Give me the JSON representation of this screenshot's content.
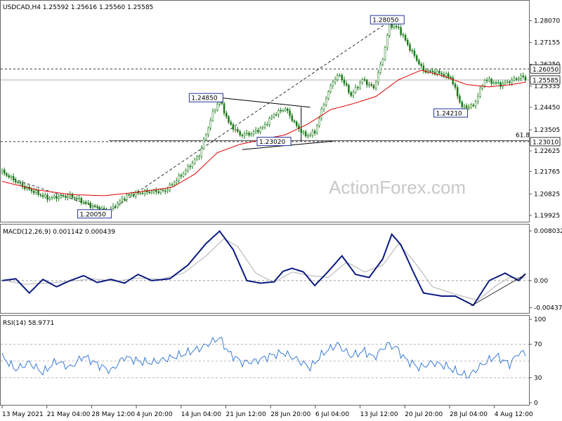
{
  "chart_data": {
    "type": "candlestick",
    "symbol_header": "USDCAD,H4  1.25592 1.25616 1.25560 1.25585",
    "watermark": "ActionForex.com",
    "colors": {
      "candles": "#1a7a1a",
      "sma": "#e00000",
      "macd": "#0a1a80",
      "signal": "#b0b0b0",
      "rsi": "#3a7bd5",
      "trend": "#000000",
      "grid": "#888888"
    },
    "price": {
      "ylim": [
        1.1975,
        1.287
      ],
      "yticks": [
        "1.28070",
        "1.27155",
        "1.26250",
        "1.25335",
        "1.24450",
        "1.23505",
        "1.22625",
        "1.21765",
        "1.20825",
        "1.19925"
      ],
      "current_price": "1.25585",
      "levels": [
        {
          "value": 1.2605,
          "label": "1.26050"
        },
        {
          "value": 1.2301,
          "label": "1.23010"
        }
      ],
      "fib_line": {
        "value": 1.2305,
        "label": "61.8"
      },
      "annotations": [
        {
          "label": "1.28050",
          "value": 1.2805,
          "idx": 170
        },
        {
          "label": "1.24850",
          "value": 1.2485,
          "idx": 95
        },
        {
          "label": "1.23020",
          "value": 1.2302,
          "idx": 120
        },
        {
          "label": "1.24210",
          "value": 1.2421,
          "idx": 198
        },
        {
          "label": "1.20050",
          "value": 1.2005,
          "idx": 47
        }
      ],
      "anchors": [
        [
          0,
          1.2175
        ],
        [
          10,
          1.211
        ],
        [
          20,
          1.2065
        ],
        [
          30,
          1.2075
        ],
        [
          40,
          1.203
        ],
        [
          47,
          1.201
        ],
        [
          55,
          1.2075
        ],
        [
          62,
          1.209
        ],
        [
          72,
          1.2095
        ],
        [
          80,
          1.217
        ],
        [
          87,
          1.2245
        ],
        [
          93,
          1.242
        ],
        [
          96,
          1.2478
        ],
        [
          100,
          1.238
        ],
        [
          105,
          1.233
        ],
        [
          110,
          1.2335
        ],
        [
          115,
          1.236
        ],
        [
          120,
          1.2415
        ],
        [
          125,
          1.244
        ],
        [
          130,
          1.2365
        ],
        [
          134,
          1.2325
        ],
        [
          138,
          1.234
        ],
        [
          142,
          1.246
        ],
        [
          146,
          1.2555
        ],
        [
          149,
          1.258
        ],
        [
          154,
          1.2495
        ],
        [
          159,
          1.256
        ],
        [
          164,
          1.2525
        ],
        [
          168,
          1.265
        ],
        [
          171,
          1.279
        ],
        [
          175,
          1.2775
        ],
        [
          180,
          1.269
        ],
        [
          186,
          1.2598
        ],
        [
          192,
          1.259
        ],
        [
          198,
          1.257
        ],
        [
          203,
          1.2445
        ],
        [
          208,
          1.245
        ],
        [
          213,
          1.256
        ],
        [
          220,
          1.254
        ],
        [
          226,
          1.256
        ],
        [
          229,
          1.2575
        ],
        [
          231,
          1.2558
        ]
      ],
      "sma_anchors": [
        [
          0,
          1.2135
        ],
        [
          15,
          1.21
        ],
        [
          30,
          1.208
        ],
        [
          45,
          1.2075
        ],
        [
          60,
          1.209
        ],
        [
          75,
          1.211
        ],
        [
          85,
          1.2165
        ],
        [
          95,
          1.2255
        ],
        [
          105,
          1.229
        ],
        [
          115,
          1.231
        ],
        [
          125,
          1.233
        ],
        [
          135,
          1.2375
        ],
        [
          145,
          1.2435
        ],
        [
          155,
          1.246
        ],
        [
          165,
          1.249
        ],
        [
          175,
          1.256
        ],
        [
          185,
          1.26
        ],
        [
          195,
          1.2575
        ],
        [
          205,
          1.254
        ],
        [
          215,
          1.253
        ],
        [
          225,
          1.254
        ],
        [
          231,
          1.255
        ]
      ]
    },
    "macd": {
      "header": "MACD(12,26,9) 0.001142 0.000439",
      "ylim": [
        -0.005,
        0.0085
      ],
      "yticks": [
        "0.008032",
        "0.00",
        "-0.004379"
      ],
      "macd_anchors": [
        [
          0,
          0.0
        ],
        [
          6,
          0.0003
        ],
        [
          12,
          -0.002
        ],
        [
          18,
          0.0002
        ],
        [
          24,
          -0.001
        ],
        [
          30,
          0.0
        ],
        [
          36,
          0.0008
        ],
        [
          42,
          -0.0003
        ],
        [
          48,
          0.0002
        ],
        [
          54,
          -0.0004
        ],
        [
          60,
          0.001
        ],
        [
          66,
          0.0
        ],
        [
          74,
          0.0003
        ],
        [
          82,
          0.0025
        ],
        [
          90,
          0.006
        ],
        [
          96,
          0.008
        ],
        [
          102,
          0.005
        ],
        [
          108,
          0.0
        ],
        [
          114,
          -0.0004
        ],
        [
          120,
          -0.0002
        ],
        [
          124,
          0.0015
        ],
        [
          128,
          0.002
        ],
        [
          133,
          0.0014
        ],
        [
          138,
          -0.0008
        ],
        [
          144,
          0.0015
        ],
        [
          150,
          0.004
        ],
        [
          156,
          0.001
        ],
        [
          162,
          0.0005
        ],
        [
          168,
          0.0035
        ],
        [
          172,
          0.0075
        ],
        [
          176,
          0.0058
        ],
        [
          182,
          0.001
        ],
        [
          186,
          -0.002
        ],
        [
          194,
          -0.0025
        ],
        [
          200,
          -0.0025
        ],
        [
          208,
          -0.004
        ],
        [
          215,
          0.0
        ],
        [
          222,
          0.0012
        ],
        [
          228,
          0.0
        ],
        [
          231,
          0.0011
        ]
      ],
      "signal_anchors": [
        [
          0,
          0.0001
        ],
        [
          10,
          -0.0006
        ],
        [
          20,
          -0.0004
        ],
        [
          30,
          -0.0001
        ],
        [
          40,
          0.0003
        ],
        [
          50,
          -0.0001
        ],
        [
          60,
          0.0004
        ],
        [
          70,
          0.0002
        ],
        [
          80,
          0.0012
        ],
        [
          90,
          0.004
        ],
        [
          98,
          0.0068
        ],
        [
          104,
          0.0055
        ],
        [
          112,
          0.0012
        ],
        [
          120,
          -0.0003
        ],
        [
          128,
          0.0014
        ],
        [
          136,
          0.0008
        ],
        [
          144,
          0.0005
        ],
        [
          152,
          0.003
        ],
        [
          160,
          0.0014
        ],
        [
          168,
          0.0025
        ],
        [
          175,
          0.006
        ],
        [
          182,
          0.003
        ],
        [
          190,
          -0.001
        ],
        [
          200,
          -0.0022
        ],
        [
          210,
          -0.0032
        ],
        [
          218,
          -0.0008
        ],
        [
          224,
          0.0005
        ],
        [
          231,
          0.0004
        ]
      ],
      "trendline": {
        "from": [
          207,
          -0.0041
        ],
        "to": [
          231,
          0.001
        ]
      }
    },
    "rsi": {
      "header": "RSI(14) 58.9771",
      "ylim": [
        0,
        100
      ],
      "yticks": [
        "100",
        "70",
        "30",
        "0"
      ],
      "levels": [
        70,
        50,
        30
      ],
      "anchors": [
        [
          0,
          55
        ],
        [
          6,
          40
        ],
        [
          12,
          48
        ],
        [
          18,
          36
        ],
        [
          24,
          50
        ],
        [
          30,
          42
        ],
        [
          36,
          56
        ],
        [
          42,
          46
        ],
        [
          48,
          38
        ],
        [
          54,
          55
        ],
        [
          60,
          50
        ],
        [
          66,
          48
        ],
        [
          72,
          52
        ],
        [
          80,
          58
        ],
        [
          88,
          66
        ],
        [
          96,
          78
        ],
        [
          100,
          60
        ],
        [
          106,
          48
        ],
        [
          112,
          50
        ],
        [
          118,
          56
        ],
        [
          124,
          60
        ],
        [
          130,
          52
        ],
        [
          136,
          42
        ],
        [
          142,
          60
        ],
        [
          148,
          70
        ],
        [
          154,
          56
        ],
        [
          160,
          62
        ],
        [
          164,
          54
        ],
        [
          170,
          70
        ],
        [
          174,
          66
        ],
        [
          178,
          52
        ],
        [
          184,
          42
        ],
        [
          190,
          48
        ],
        [
          196,
          44
        ],
        [
          202,
          35
        ],
        [
          206,
          32
        ],
        [
          212,
          46
        ],
        [
          218,
          56
        ],
        [
          224,
          46
        ],
        [
          228,
          60
        ],
        [
          231,
          59
        ]
      ]
    },
    "x_labels": [
      "13 May 2021",
      "21 May 04:00",
      "28 May 12:00",
      "4 Jun 20:00",
      "14 Jun 04:00",
      "21 Jun 12:00",
      "28 Jun 20:00",
      "6 Jul 04:00",
      "13 Jul 12:00",
      "20 Jul 20:00",
      "28 Jul 04:00",
      "4 Aug 12:00"
    ]
  }
}
